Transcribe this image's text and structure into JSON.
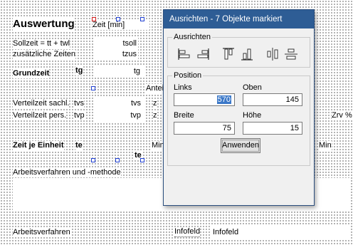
{
  "form": {
    "title": "Auswertung",
    "zeit_label": "Zeit [min]",
    "sollzeit_label": "Sollzeit = tt + twl",
    "tsoll": "tsoll",
    "zusatz_label": "zusätzliche Zeiten",
    "tzus": "tzus",
    "grundzeit_label": "Grundzeit",
    "tg_short": "tg",
    "tg_field": "tg",
    "anteil_label": "Anteil",
    "verteil_sach_label": "Verteilzeit sachl.",
    "tvs_short": "tvs",
    "tvs_field": "tvs",
    "z1": "z",
    "verteil_pers_label": "Verteilzeit pers.",
    "tvp_short": "tvp",
    "tvp_field": "tvp",
    "z2": "z",
    "zrv": "Zrv %",
    "zeit_je_einheit_label": "Zeit je Einheit",
    "te_short": "te",
    "min1": "Min",
    "min2": "Min",
    "te_field": "te",
    "arbeitsverfahren_methode_label": "Arbeitsverfahren und -methode",
    "arbeitsverfahren_label": "Arbeitsverfahren",
    "infofeld_label": "Infofeld",
    "infofeld_value": "Infofeld"
  },
  "dialog": {
    "title": "Ausrichten - 7 Objekte markiert",
    "ausrichten_group": "Ausrichten",
    "align_buttons": [
      "align-left-icon",
      "align-right-icon",
      "align-top-icon",
      "align-bottom-icon",
      "align-center-horizontal-icon",
      "align-center-vertical-icon"
    ],
    "position_group": "Position",
    "links_label": "Links",
    "links_value": "570",
    "oben_label": "Oben",
    "oben_value": "145",
    "breite_label": "Breite",
    "breite_value": "75",
    "hoehe_label": "Höhe",
    "hoehe_value": "15",
    "apply_button": "Anwenden"
  },
  "colors": {
    "title_bar": "#2e5d95",
    "selection_handle": "#1f3fd0",
    "primary_handle": "#d01818",
    "text_highlight": "#3b78c8"
  }
}
